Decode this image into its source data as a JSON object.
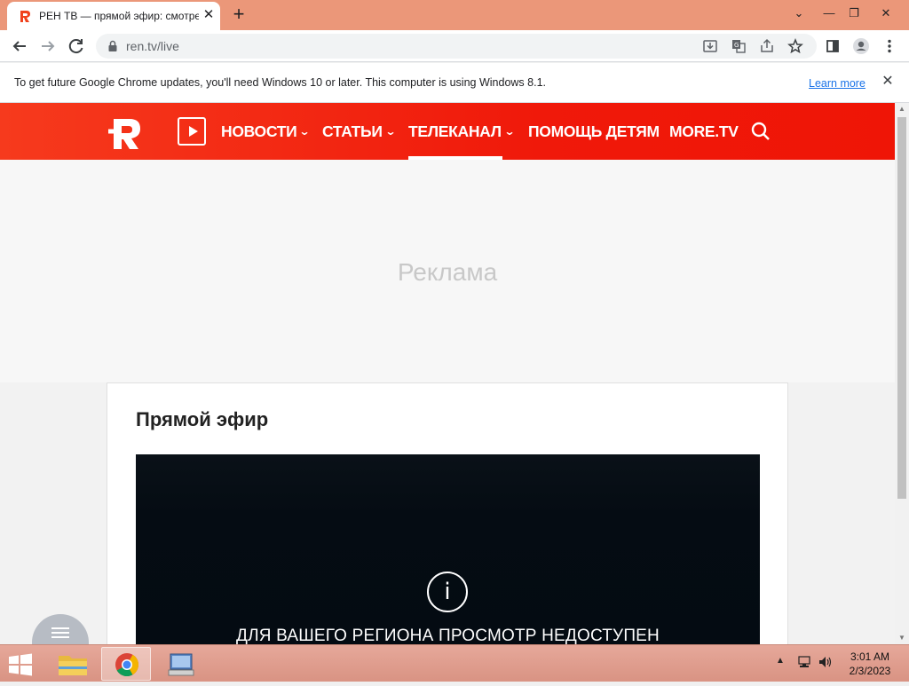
{
  "browser": {
    "tab_title": "РЕН ТВ — прямой эфир: смотре",
    "tab_close": "✕",
    "new_tab": "+",
    "window_controls": {
      "minimize": "—",
      "restore": "❐",
      "close": "✕",
      "tab_search": "⌄"
    },
    "url": "ren.tv/live",
    "infobar": {
      "text": "To get future Google Chrome updates, you'll need Windows 10 or later. This computer is using Windows 8.1.",
      "link": "Learn more",
      "close": "✕"
    }
  },
  "site": {
    "nav": [
      {
        "label": "НОВОСТИ",
        "has_dropdown": true
      },
      {
        "label": "СТАТЬИ",
        "has_dropdown": true
      },
      {
        "label": "ТЕЛЕКАНАЛ",
        "has_dropdown": true,
        "active": true
      },
      {
        "label": "ПОМОЩЬ ДЕТЯМ",
        "has_dropdown": false
      },
      {
        "label": "MORE.TV",
        "has_dropdown": false
      }
    ],
    "chevron": "⌄",
    "ad_label": "Реклама",
    "section_title": "Прямой эфир",
    "player": {
      "info_icon": "i",
      "message": "ДЛЯ ВАШЕГО РЕГИОНА ПРОСМОТР НЕДОСТУПЕН"
    },
    "colors": {
      "brand_red": "#f0190a",
      "player_bg": "#050c13"
    }
  },
  "taskbar": {
    "time": "3:01 AM",
    "date": "2/3/2023",
    "tray_expand": "▲"
  }
}
